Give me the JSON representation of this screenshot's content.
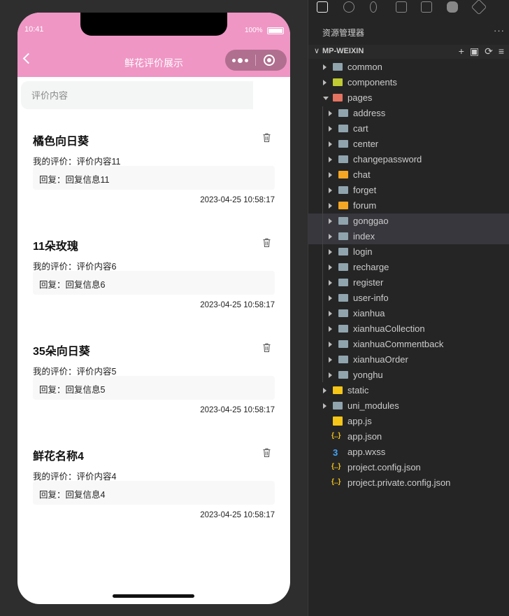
{
  "phone": {
    "time": "10:41",
    "battery": "100%",
    "title": "鲜花评价展示",
    "search_placeholder": "评价内容",
    "comments": [
      {
        "name": "橘色向日葵",
        "review": "我的评价：评价内容11",
        "reply": "回复：回复信息11",
        "date": "2023-04-25 10:58:17"
      },
      {
        "name": "11朵玫瑰",
        "review": "我的评价：评价内容6",
        "reply": "回复：回复信息6",
        "date": "2023-04-25 10:58:17"
      },
      {
        "name": "35朵向日葵",
        "review": "我的评价：评价内容5",
        "reply": "回复：回复信息5",
        "date": "2023-04-25 10:58:17"
      },
      {
        "name": "鲜花名称4",
        "review": "我的评价：评价内容4",
        "reply": "回复：回复信息4",
        "date": "2023-04-25 10:58:17"
      }
    ]
  },
  "explorer": {
    "header": "资源管理器",
    "more": "···",
    "project": "MP-WEIXIN",
    "tree": [
      {
        "label": "common",
        "level": 1,
        "type": "folder",
        "color": "#90a4ae"
      },
      {
        "label": "components",
        "level": 1,
        "type": "folder",
        "color": "#c0ca33"
      },
      {
        "label": "pages",
        "level": 1,
        "type": "folder-open",
        "color": "#e57361"
      },
      {
        "label": "address",
        "level": 2,
        "type": "folder",
        "color": "#90a4ae"
      },
      {
        "label": "cart",
        "level": 2,
        "type": "folder",
        "color": "#90a4ae"
      },
      {
        "label": "center",
        "level": 2,
        "type": "folder",
        "color": "#90a4ae"
      },
      {
        "label": "changepassword",
        "level": 2,
        "type": "folder",
        "color": "#90a4ae"
      },
      {
        "label": "chat",
        "level": 2,
        "type": "folder",
        "color": "#f5a623"
      },
      {
        "label": "forget",
        "level": 2,
        "type": "folder",
        "color": "#90a4ae"
      },
      {
        "label": "forum",
        "level": 2,
        "type": "folder",
        "color": "#f5a623"
      },
      {
        "label": "gonggao",
        "level": 2,
        "type": "folder",
        "color": "#90a4ae",
        "highlight": true
      },
      {
        "label": "index",
        "level": 2,
        "type": "folder",
        "color": "#90a4ae",
        "highlight": true
      },
      {
        "label": "login",
        "level": 2,
        "type": "folder",
        "color": "#90a4ae"
      },
      {
        "label": "recharge",
        "level": 2,
        "type": "folder",
        "color": "#90a4ae"
      },
      {
        "label": "register",
        "level": 2,
        "type": "folder",
        "color": "#90a4ae"
      },
      {
        "label": "user-info",
        "level": 2,
        "type": "folder",
        "color": "#90a4ae"
      },
      {
        "label": "xianhua",
        "level": 2,
        "type": "folder",
        "color": "#90a4ae"
      },
      {
        "label": "xianhuaCollection",
        "level": 2,
        "type": "folder",
        "color": "#90a4ae"
      },
      {
        "label": "xianhuaCommentback",
        "level": 2,
        "type": "folder",
        "color": "#90a4ae"
      },
      {
        "label": "xianhuaOrder",
        "level": 2,
        "type": "folder",
        "color": "#90a4ae"
      },
      {
        "label": "yonghu",
        "level": 2,
        "type": "folder",
        "color": "#90a4ae"
      },
      {
        "label": "static",
        "level": 1,
        "type": "folder",
        "color": "#f5c518"
      },
      {
        "label": "uni_modules",
        "level": 1,
        "type": "folder",
        "color": "#90a4ae"
      },
      {
        "label": "app.js",
        "level": 1,
        "type": "js",
        "color": "#f5c518"
      },
      {
        "label": "app.json",
        "level": 1,
        "type": "json",
        "color": "#f5c518"
      },
      {
        "label": "app.wxss",
        "level": 1,
        "type": "css",
        "color": "#42a5f5"
      },
      {
        "label": "project.config.json",
        "level": 1,
        "type": "json",
        "color": "#f5c518"
      },
      {
        "label": "project.private.config.json",
        "level": 1,
        "type": "json",
        "color": "#f5c518"
      }
    ]
  }
}
